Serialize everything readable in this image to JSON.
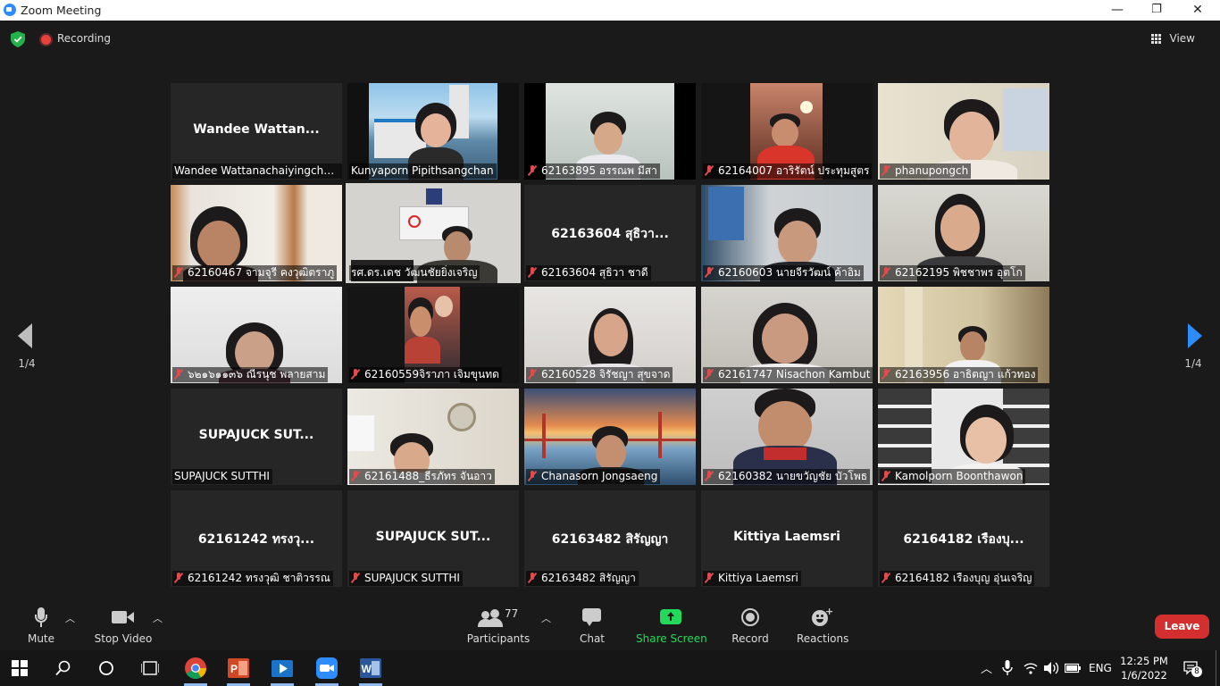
{
  "window": {
    "title": "Zoom Meeting",
    "minimize": "—",
    "maximize": "❐",
    "close": "✕"
  },
  "topbar": {
    "recording_label": "Recording",
    "view_label": "View"
  },
  "pager": {
    "left": "1/4",
    "right": "1/4"
  },
  "tiles": [
    {
      "label": "Wandee Wattanachaiyingcharoen",
      "big": "Wandee  Wattan...",
      "muted": false
    },
    {
      "label": "Kunyaporn  Pipithsangchan",
      "muted": false
    },
    {
      "label": "62163895 อรรณพ มีสา",
      "muted": true
    },
    {
      "label": "62164007 อาริรัตน์ ประทุมสูตร",
      "muted": true
    },
    {
      "label": "phanupongch",
      "muted": true
    },
    {
      "label": "62160467 จามจุรี คงวุฒิตราภู",
      "muted": true
    },
    {
      "label": "รศ.ดร.เดช วัฒนชัยยิ่งเจริญ",
      "muted": false
    },
    {
      "label": "62163604  สุธิวา ชาดี",
      "big": "62163604  สุธิวา...",
      "muted": true
    },
    {
      "label": "62160603 นายจีรวัฒน์ ค้าอิม",
      "muted": true
    },
    {
      "label": "62162195 พิชชาพร อุตโก",
      "muted": true
    },
    {
      "label": "๖๒๑๖๑๑๓๖ ณีรนุช พลายสาม",
      "muted": true
    },
    {
      "label": "62160559จิราภา เจิมขุนทด",
      "muted": true
    },
    {
      "label": "62160528 จิรัชญา สุขจาด",
      "muted": true
    },
    {
      "label": "62161747 Nisachon Kambut",
      "muted": true
    },
    {
      "label": "62163956 อาธิตญา  แก้วทอง",
      "muted": true
    },
    {
      "label": "SUPAJUCK SUTTHI",
      "big": "SUPAJUCK  SUT...",
      "muted": false
    },
    {
      "label": "62161488_ธีรภัทร จันอาว",
      "muted": true
    },
    {
      "label": "Chanasorn Jongsaeng",
      "muted": true
    },
    {
      "label": "62160382 นายขวัญชัย บัวโพธ",
      "muted": true
    },
    {
      "label": "Kamolporn Boonthawon",
      "muted": true
    },
    {
      "label": "62161242 ทรงวุฒิ ชาติวรรณ",
      "big": "62161242 ทรงวุ...",
      "muted": true
    },
    {
      "label": "SUPAJUCK SUTTHI",
      "big": "SUPAJUCK  SUT...",
      "muted": true
    },
    {
      "label": "62163482 สิรัญญา",
      "big": "62163482 สิรัญญา",
      "muted": true
    },
    {
      "label": "Kittiya Laemsri",
      "big": "Kittiya Laemsri",
      "muted": true
    },
    {
      "label": "62164182 เรืองบุญ อุ่นเจริญ",
      "big": "62164182 เรืองบุ...",
      "muted": true
    }
  ],
  "toolbar": {
    "mute": "Mute",
    "stop_video": "Stop Video",
    "participants": "Participants",
    "participants_count": "77",
    "chat": "Chat",
    "share_screen": "Share Screen",
    "record": "Record",
    "reactions": "Reactions",
    "leave": "Leave"
  },
  "taskbar": {
    "language": "ENG",
    "time": "12:25 PM",
    "date": "1/6/2022",
    "notifications": "8"
  },
  "colors": {
    "accent": "#2d8cff",
    "share_green": "#23d959",
    "leave_red": "#d32f2f",
    "active_speaker": "#c8e45a",
    "muted_red": "#e24b4b"
  }
}
